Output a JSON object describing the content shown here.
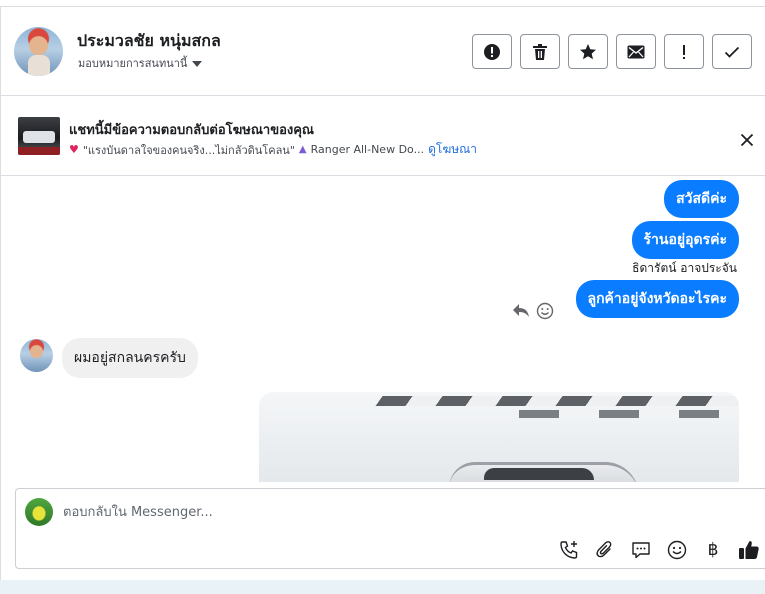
{
  "header": {
    "contact_name": "ประมวลชัย หนุ่มสกล",
    "assign_label": "มอบหมายการสนทนานี้",
    "actions": [
      {
        "name": "report-spam-button",
        "icon": "exclamation-circle-icon"
      },
      {
        "name": "delete-button",
        "icon": "trash-icon"
      },
      {
        "name": "star-button",
        "icon": "star-icon"
      },
      {
        "name": "mark-unread-button",
        "icon": "envelope-icon"
      },
      {
        "name": "follow-up-button",
        "icon": "exclamation-icon"
      },
      {
        "name": "mark-done-button",
        "icon": "checkmark-icon"
      }
    ]
  },
  "ad_banner": {
    "title": "แชทนี้มีข้อความตอบกลับต่อโฆษณาของคุณ",
    "ad_text": "\"แรงบันดาลใจของคนจริง...ไม่กลัวดินโคลน\"",
    "vehicle_text": "Ranger All-New Do...",
    "view_ad_label": "ดูโฆษณา"
  },
  "messages": {
    "outgoing": [
      {
        "text": "สวัสดีค่ะ"
      },
      {
        "text": "ร้านอยู่อุดรค่ะ"
      },
      {
        "text": "ลูกค้าอยู่จังหวัดอะไรคะ"
      }
    ],
    "sender_name": "ธิดารัตน์ อาจประจัน",
    "incoming": [
      {
        "text": "ผมอยู่สกลนครครับ"
      }
    ]
  },
  "composer": {
    "placeholder": "ตอบกลับใน Messenger..."
  },
  "toolbar": {
    "baht_symbol": "฿"
  },
  "colors": {
    "accent": "#0a7cff",
    "link": "#216fdb",
    "incoming_bubble": "#f0f0f0"
  }
}
